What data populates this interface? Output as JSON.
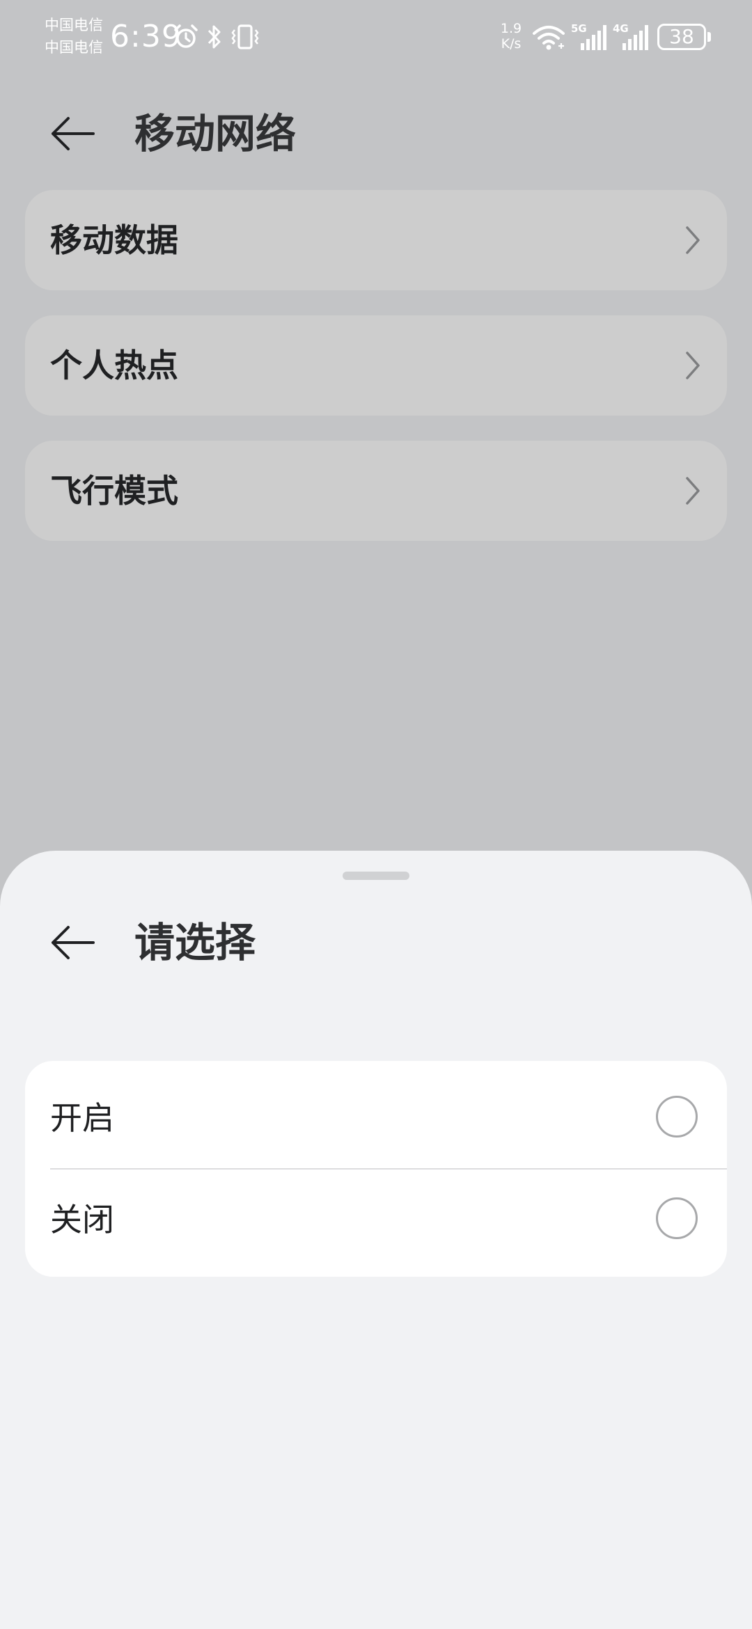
{
  "status_bar": {
    "carrier_1": "中国电信",
    "carrier_2": "中国电信",
    "time": "6:39",
    "net_speed_value": "1.9",
    "net_speed_unit": "K/s",
    "signal_1_label": "5G",
    "signal_2_label": "4G",
    "battery": "38",
    "icons": [
      "alarm-icon",
      "bluetooth-icon",
      "vibrate-icon",
      "wifi-icon",
      "signal-icon",
      "battery-icon"
    ]
  },
  "header": {
    "back_icon": "arrow-left-icon",
    "title": "移动网络"
  },
  "menu": {
    "items": [
      {
        "label": "移动数据"
      },
      {
        "label": "个人热点"
      },
      {
        "label": "飞行模式"
      }
    ]
  },
  "sheet": {
    "back_icon": "arrow-left-icon",
    "title": "请选择",
    "options": [
      {
        "label": "开启",
        "selected": false
      },
      {
        "label": "关闭",
        "selected": false
      }
    ]
  },
  "colors": {
    "dim_background": "#c3c4c6",
    "menu_card": "#cdcdcd",
    "sheet_background": "#f1f2f4",
    "option_card": "#ffffff",
    "radio_border": "#a7a8aa"
  }
}
